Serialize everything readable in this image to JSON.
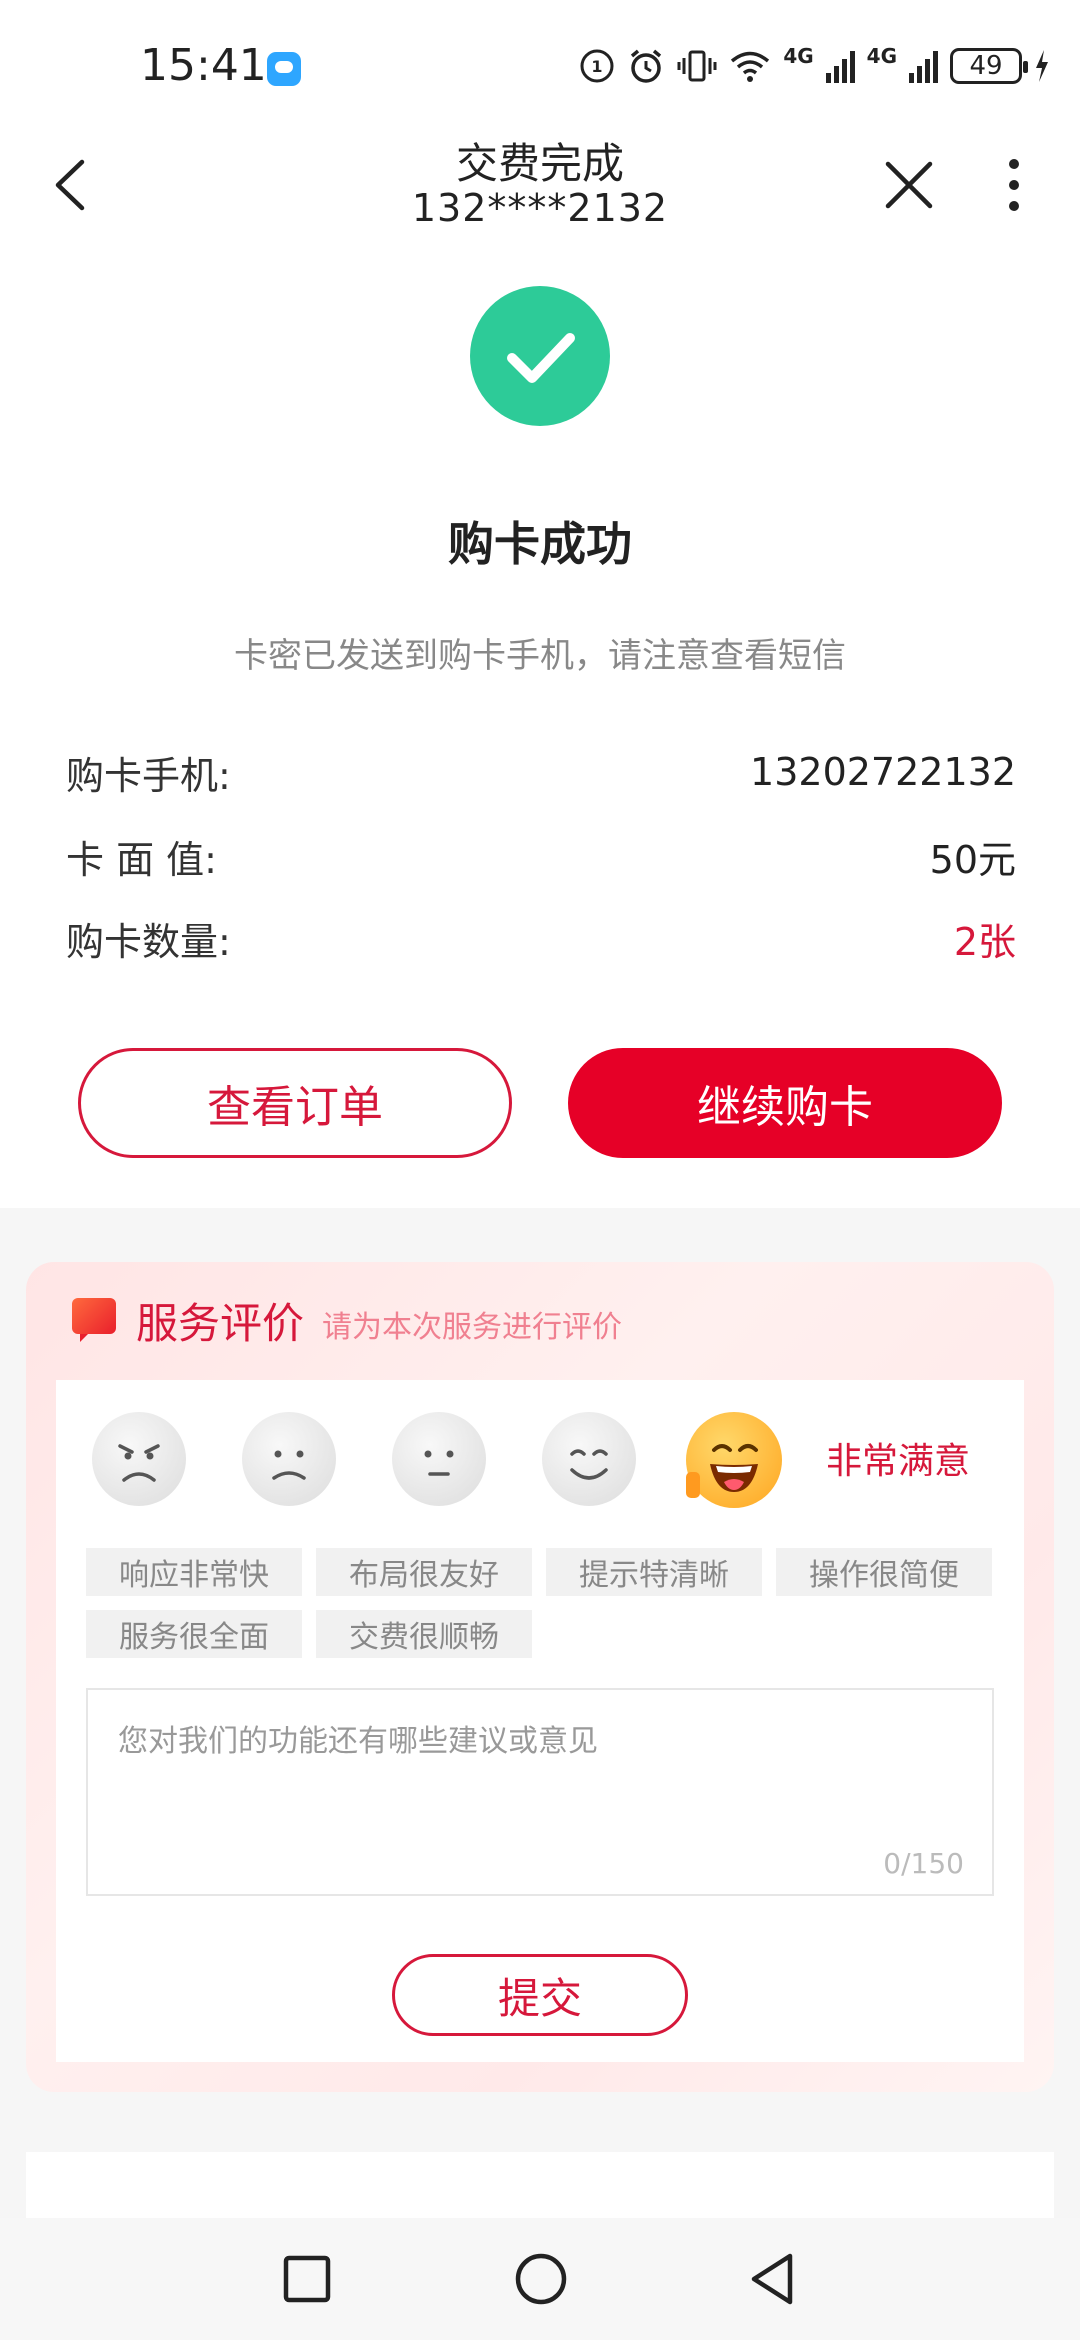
{
  "status_bar": {
    "time": "15:41",
    "net1": "4G",
    "net2": "4G",
    "battery": "49"
  },
  "header": {
    "title": "交费完成",
    "subtitle": "132****2132"
  },
  "result": {
    "title": "购卡成功",
    "desc": "卡密已发送到购卡手机，请注意查看短信"
  },
  "info": {
    "phone_label": "购卡手机:",
    "phone_value": "13202722132",
    "value_label": "卡 面 值:",
    "value_value": "50元",
    "qty_label": "购卡数量:",
    "qty_value": "2张"
  },
  "actions": {
    "view_order": "查看订单",
    "continue_buy": "继续购卡"
  },
  "evaluation": {
    "title": "服务评价",
    "subtitle": "请为本次服务进行评价",
    "selected_label": "非常满意",
    "tags": [
      "响应非常快",
      "布局很友好",
      "提示特清晰",
      "操作很简便",
      "服务很全面",
      "交费很顺畅"
    ],
    "placeholder": "您对我们的功能还有哪些建议或意见",
    "counter": "0/150",
    "submit": "提交"
  },
  "colors": {
    "brand_red": "#e60027",
    "success_green": "#2dcb98"
  }
}
